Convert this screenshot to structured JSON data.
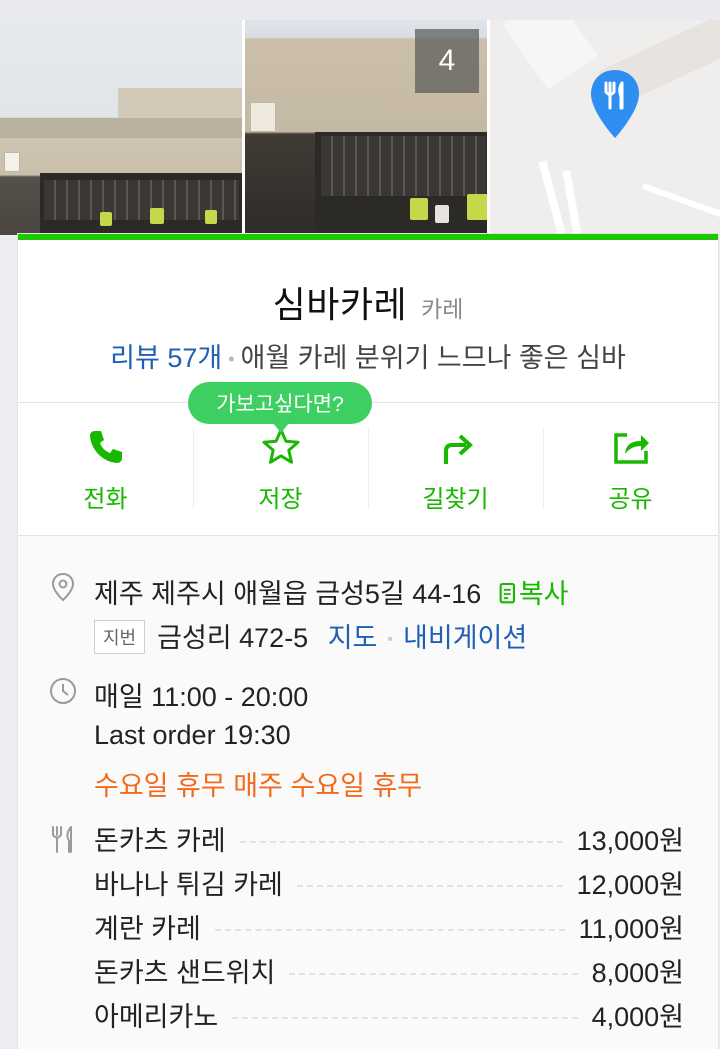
{
  "photos": {
    "count_badge": "4"
  },
  "place": {
    "name": "심바카레",
    "category": "카레"
  },
  "review": {
    "count_label": "리뷰 57개",
    "separator": "•",
    "summary": "애월 카레 분위기 느므나 좋은 심바"
  },
  "tooltip": "가보고싶다면?",
  "actions": [
    {
      "label": "전화",
      "icon": "phone-icon"
    },
    {
      "label": "저장",
      "icon": "star-icon"
    },
    {
      "label": "길찾기",
      "icon": "directions-icon"
    },
    {
      "label": "공유",
      "icon": "share-icon"
    }
  ],
  "address": {
    "road": "제주 제주시 애월읍 금성5길 44-16",
    "copy_label": "복사",
    "jibun_tag": "지번",
    "jibun": "금성리 472-5",
    "map_link": "지도",
    "separator": "•",
    "navigation_link": "내비게이션"
  },
  "hours": {
    "daily": "매일 11:00 - 20:00",
    "last_order": "Last order 19:30",
    "holiday": "수요일 휴무 매주 수요일 휴무"
  },
  "menu": [
    {
      "name": "돈카츠 카레",
      "price": "13,000원"
    },
    {
      "name": "바나나 튀김 카레",
      "price": "12,000원"
    },
    {
      "name": "계란 카레",
      "price": "11,000원"
    },
    {
      "name": "돈카츠 샌드위치",
      "price": "8,000원"
    },
    {
      "name": "아메리카노",
      "price": "4,000원"
    }
  ],
  "colors": {
    "brand_green": "#1ec800",
    "link_blue": "#1f5fb4",
    "holiday_orange": "#f26b1d"
  }
}
